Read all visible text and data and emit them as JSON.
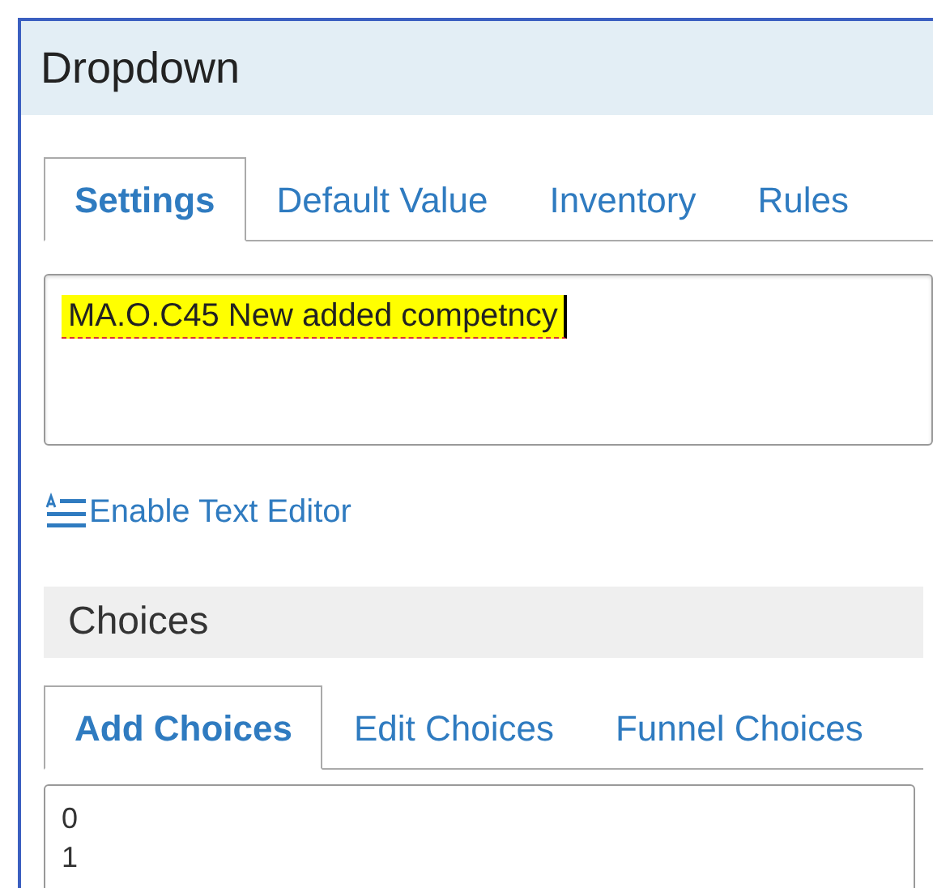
{
  "panel": {
    "title": "Dropdown"
  },
  "tabs": [
    {
      "label": "Settings",
      "selected": true
    },
    {
      "label": "Default Value",
      "selected": false
    },
    {
      "label": "Inventory",
      "selected": false
    },
    {
      "label": "Rules",
      "selected": false
    }
  ],
  "question_field": {
    "value": "MA.O.C45 New added competncy",
    "highlighted": true
  },
  "text_editor_link": "Enable Text Editor",
  "choices": {
    "title": "Choices",
    "tabs": [
      {
        "label": "Add Choices",
        "selected": true
      },
      {
        "label": "Edit Choices",
        "selected": false
      },
      {
        "label": "Funnel Choices",
        "selected": false
      }
    ],
    "lines": [
      "0",
      "1"
    ]
  }
}
